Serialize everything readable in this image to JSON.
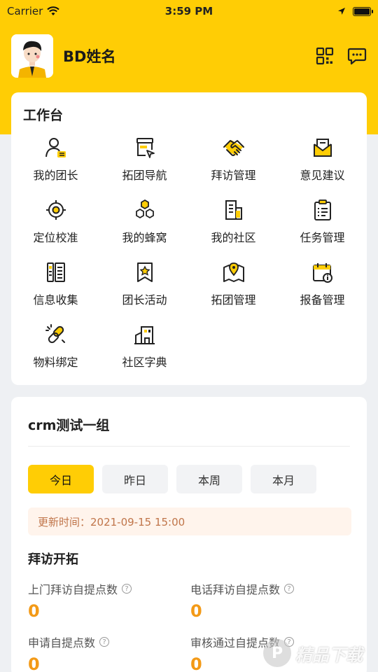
{
  "status_bar": {
    "carrier": "Carrier",
    "time": "3:59 PM"
  },
  "profile": {
    "name": "BD姓名"
  },
  "workbench": {
    "title": "工作台",
    "items": [
      {
        "label": "我的团长",
        "icon": "leader-icon"
      },
      {
        "label": "拓团导航",
        "icon": "navigation-icon"
      },
      {
        "label": "拜访管理",
        "icon": "handshake-icon"
      },
      {
        "label": "意见建议",
        "icon": "mail-icon"
      },
      {
        "label": "定位校准",
        "icon": "target-icon"
      },
      {
        "label": "我的蜂窝",
        "icon": "hexagons-icon"
      },
      {
        "label": "我的社区",
        "icon": "document-icon"
      },
      {
        "label": "任务管理",
        "icon": "clipboard-icon"
      },
      {
        "label": "信息收集",
        "icon": "info-collect-icon"
      },
      {
        "label": "团长活动",
        "icon": "badge-star-icon"
      },
      {
        "label": "拓团管理",
        "icon": "map-pin-icon"
      },
      {
        "label": "报备管理",
        "icon": "calendar-info-icon"
      },
      {
        "label": "物料绑定",
        "icon": "link-icon"
      },
      {
        "label": "社区字典",
        "icon": "building-icon"
      }
    ]
  },
  "group": {
    "title": "crm测试一组",
    "tabs": [
      "今日",
      "昨日",
      "本周",
      "本月"
    ],
    "update_time": "更新时间：2021-09-15 15:00",
    "section_title": "拜访开拓",
    "stats": [
      {
        "label": "上门拜访自提点数",
        "value": "0"
      },
      {
        "label": "电话拜访自提点数",
        "value": "0"
      },
      {
        "label": "申请自提点数",
        "value": "0"
      },
      {
        "label": "审核通过自提点数",
        "value": "0"
      }
    ]
  },
  "watermark": {
    "text": "精品下载"
  },
  "colors": {
    "brand": "#ffcd05",
    "value": "#f39a17",
    "update_bg": "#fff4ec",
    "update_text": "#c0754a"
  }
}
